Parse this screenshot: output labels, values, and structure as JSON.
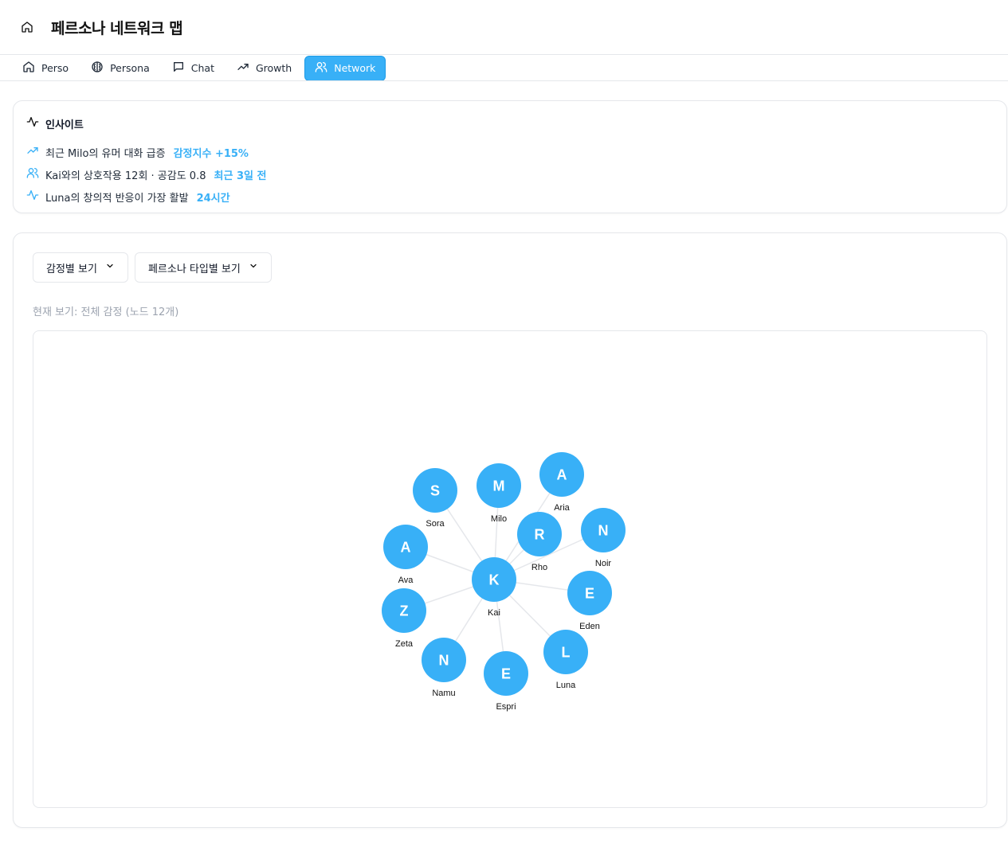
{
  "header": {
    "title": "페르소나 네트워크 맵",
    "home_icon": "home-icon"
  },
  "tabs": [
    {
      "label": "Perso",
      "icon": "home-icon",
      "active": false
    },
    {
      "label": "Persona",
      "icon": "brain-icon",
      "active": false
    },
    {
      "label": "Chat",
      "icon": "message-icon",
      "active": false
    },
    {
      "label": "Growth",
      "icon": "trending-up-icon",
      "active": false
    },
    {
      "label": "Network",
      "icon": "users-icon",
      "active": true
    }
  ],
  "insight": {
    "title": "인사이트",
    "rows": [
      {
        "icon": "trending-up-icon",
        "text": "최근 Milo의 유머 대화 급증",
        "highlight": "감정지수 +15%"
      },
      {
        "icon": "users-icon",
        "text": "Kai와의 상호작용 12회 · 공감도 0.8",
        "highlight": "최근 3일 전"
      },
      {
        "icon": "activity-icon",
        "text": "Luna의 창의적 반응이 가장 활발",
        "highlight": "24시간"
      }
    ]
  },
  "controls": {
    "emotion_view": "감정별 보기",
    "type_view": "페르소나 타입별 보기"
  },
  "caption": "현재 보기: 전체 감정 (노드 12개)",
  "network": {
    "accent": "#38b0f7",
    "center": {
      "letter": "K",
      "name": "Kai"
    },
    "nodes": [
      {
        "letter": "S",
        "name": "Sora"
      },
      {
        "letter": "M",
        "name": "Milo"
      },
      {
        "letter": "A",
        "name": "Aria"
      },
      {
        "letter": "R",
        "name": "Rho"
      },
      {
        "letter": "N",
        "name": "Noir"
      },
      {
        "letter": "A",
        "name": "Ava"
      },
      {
        "letter": "E",
        "name": "Eden"
      },
      {
        "letter": "Z",
        "name": "Zeta"
      },
      {
        "letter": "L",
        "name": "Luna"
      },
      {
        "letter": "N",
        "name": "Namu"
      },
      {
        "letter": "E",
        "name": "Espri"
      }
    ]
  }
}
